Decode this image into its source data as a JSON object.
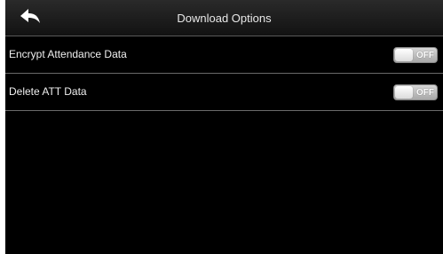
{
  "header": {
    "title": "Download Options",
    "back_icon": "back-arrow-icon"
  },
  "settings": [
    {
      "label": "Encrypt Attendance Data",
      "state": "OFF"
    },
    {
      "label": "Delete ATT Data",
      "state": "OFF"
    }
  ],
  "colors": {
    "background": "#000000",
    "header": "#1e1e1e",
    "divider": "#6a6a6a",
    "toggle_off": "#b8b8b8"
  }
}
